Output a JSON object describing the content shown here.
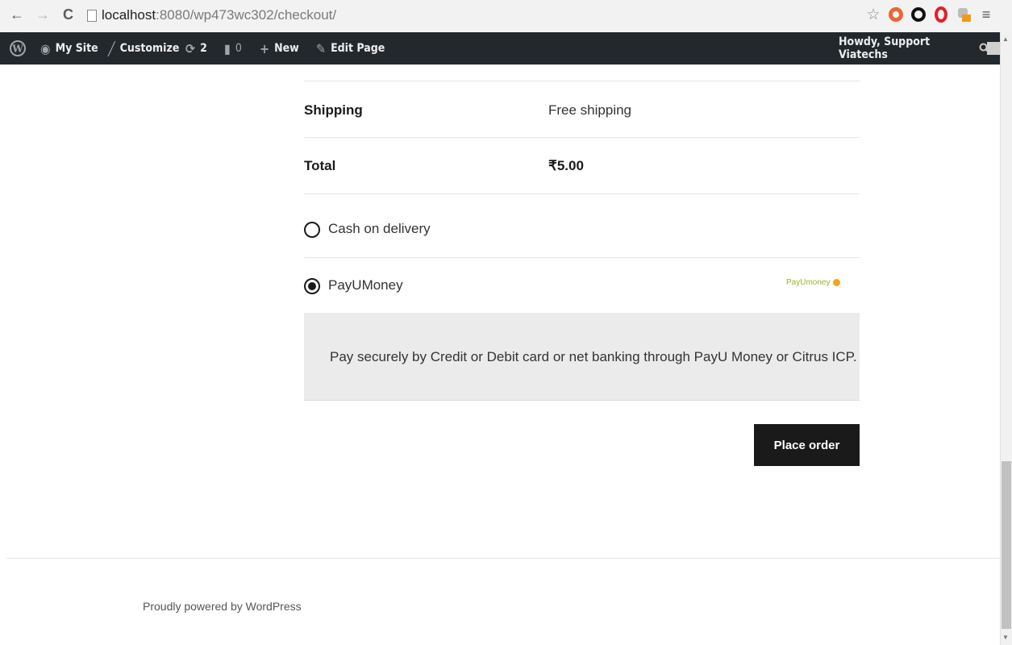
{
  "browser": {
    "url_host": "localhost",
    "url_path": ":8080/wp473wc302/checkout/"
  },
  "adminbar": {
    "my_site": "My Site",
    "customize": "Customize",
    "updates_count": "2",
    "comments_count": "0",
    "new": "New",
    "edit_page": "Edit Page",
    "howdy": "Howdy, Support Viatechs"
  },
  "order": {
    "shipping_label": "Shipping",
    "shipping_value": "Free shipping",
    "total_label": "Total",
    "total_value": "₹5.00"
  },
  "payment_methods": [
    {
      "label": "Cash on delivery",
      "selected": false
    },
    {
      "label": "PayUMoney",
      "selected": true,
      "logo_text": "PayUmoney"
    }
  ],
  "payment_description": "Pay securely by Credit or Debit card or net banking through PayU Money or Citrus ICP.",
  "place_order_label": "Place order",
  "footer_text": "Proudly powered by WordPress",
  "colors": {
    "adminbar_bg": "#23282d",
    "button_bg": "#1a1a1a",
    "description_bg": "#ebebeb",
    "payu_green": "#9fb32b",
    "payu_orange": "#f7a21b"
  },
  "icons": [
    "back-arrow-icon",
    "forward-arrow-icon",
    "reload-icon",
    "page-icon",
    "star-icon",
    "wordpress-logo-icon",
    "dashboard-icon",
    "brush-icon",
    "refresh-icon",
    "comment-icon",
    "plus-icon",
    "pencil-icon",
    "avatar",
    "search-icon",
    "menu-icon"
  ]
}
